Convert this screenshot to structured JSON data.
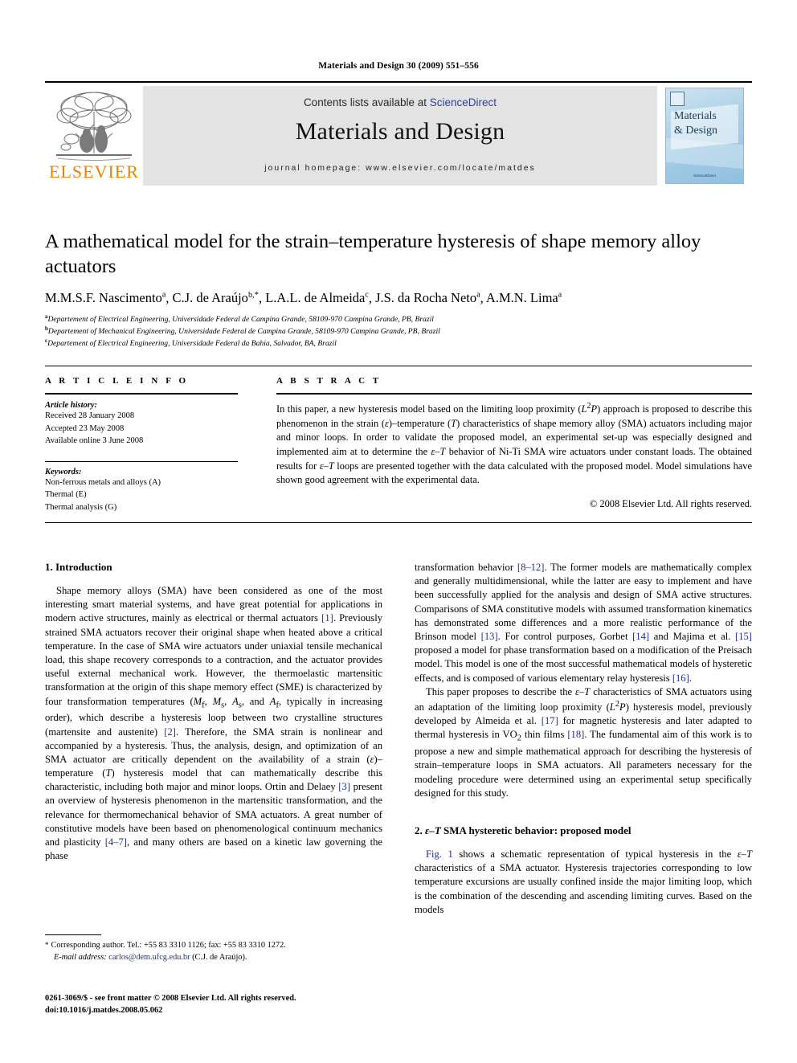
{
  "running_head": "Materials and Design 30 (2009) 551–556",
  "masthead": {
    "publisher_name": "ELSEVIER",
    "contents_prefix": "Contents lists available at ",
    "contents_link": "ScienceDirect",
    "journal_title": "Materials and Design",
    "homepage": "journal homepage: www.elsevier.com/locate/matdes",
    "cover_title_line1": "Materials",
    "cover_title_line2": "& Design",
    "cover_footer": "Available online at\nScienceDirect\nwww.sciencedirect.com"
  },
  "article": {
    "title": "A mathematical model for the strain–temperature hysteresis of shape memory alloy actuators",
    "authors": "M.M.S.F. Nascimento a, C.J. de Araújo b,*, L.A.L. de Almeida c, J.S. da Rocha Neto a, A.M.N. Lima a",
    "affiliations": [
      "Departement of Electrical Engineering, Universidade Federal de Campina Grande, 58109-970 Campina Grande, PB, Brazil",
      "Departement of Mechanical Engineering, Universidade Federal de Campina Grande, 58109-970 Campina Grande, PB, Brazil",
      "Departement of Electrical Engineering, Universidade Federal da Bahia, Salvador, BA, Brazil"
    ],
    "affiliation_marks": [
      "a",
      "b",
      "c"
    ]
  },
  "article_info": {
    "heading": "A R T I C L E   I N F O",
    "history_label": "Article history:",
    "history": [
      "Received 28 January 2008",
      "Accepted 23 May 2008",
      "Available online 3 June 2008"
    ],
    "keywords_label": "Keywords:",
    "keywords": [
      "Non-ferrous metals and alloys (A)",
      "Thermal (E)",
      "Thermal analysis (G)"
    ]
  },
  "abstract": {
    "heading": "A B S T R A C T",
    "text": "In this paper, a new hysteresis model based on the limiting loop proximity (L2P) approach is proposed to describe this phenomenon in the strain (ε)–temperature (T) characteristics of shape memory alloy (SMA) actuators including major and minor loops. In order to validate the proposed model, an experimental set-up was especially designed and implemented aim at to determine the ε–T behavior of Ni-Ti SMA wire actuators under constant loads. The obtained results for ε–T loops are presented together with the data calculated with the proposed model. Model simulations have shown good agreement with the experimental data.",
    "copyright": "© 2008 Elsevier Ltd. All rights reserved."
  },
  "sections": {
    "intro_heading": "1. Introduction",
    "model_heading": "2. ε–T SMA hysteretic behavior: proposed model",
    "intro_p1": "Shape memory alloys (SMA) have been considered as one of the most interesting smart material systems, and have great potential for applications in modern active structures, mainly as electrical or thermal actuators [1]. Previously strained SMA actuators recover their original shape when heated above a critical temperature. In the case of SMA wire actuators under uniaxial tensile mechanical load, this shape recovery corresponds to a contraction, and the actuator provides useful external mechanical work. However, the thermoelastic martensitic transformation at the origin of this shape memory effect (SME) is characterized by four transformation temperatures (Mf, Ms, As, and Af, typically in increasing order), which describe a hysteresis loop between two crystalline structures (martensite and austenite) [2]. Therefore, the SMA strain is nonlinear and accompanied by a hysteresis. Thus, the analysis, design, and optimization of an SMA actuator are critically dependent on the availability of a strain (ε)–temperature (T) hysteresis model that can mathematically describe this characteristic, including both major and minor loops. Ortin and Delaey [3] present an overview of hysteresis phenomenon in the martensitic transformation, and the relevance for thermomechanical behavior of SMA actuators. A great number of constitutive models have been based on phenomenological continuum mechanics and plasticity [4–7], and many others are based on a kinetic law governing the phase transformation behavior [8–12]. The former models are mathematically complex and generally multidimensional, while the latter are easy to implement and have been successfully applied for the analysis and design of SMA active structures. Comparisons of SMA constitutive models with assumed transformation kinematics has demonstrated some differences and a more realistic performance of the Brinson model [13]. For control purposes, Gorbet [14] and Majima et al. [15] proposed a model for phase transformation based on a modification of the Preisach model. This model is one of the most successful mathematical models of hysteretic effects, and is composed of various elementary relay hysteresis [16].",
    "intro_p2": "This paper proposes to describe the ε–T characteristics of SMA actuators using an adaptation of the limiting loop proximity (L2P) hysteresis model, previously developed by Almeida et al. [17] for magnetic hysteresis and later adapted to thermal hysteresis in VO2 thin films [18]. The fundamental aim of this work is to propose a new and simple mathematical approach for describing the hysteresis of strain–temperature loops in SMA actuators. All parameters necessary for the modeling procedure were determined using an experimental setup specifically designed for this study.",
    "model_p1": "Fig. 1 shows a schematic representation of typical hysteresis in the ε–T characteristics of a SMA actuator. Hysteresis trajectories corresponding to low temperature excursions are usually confined inside the major limiting loop, which is the combination of the descending and ascending limiting curves. Based on the models"
  },
  "footnote": {
    "marker": "*",
    "line1": "Corresponding author. Tel.: +55 83 3310 1126; fax: +55 83 3310 1272.",
    "email_label": "E-mail address:",
    "email": "carlos@dem.ufcg.edu.br",
    "email_suffix": "(C.J. de Araújo)."
  },
  "colophon": {
    "line1": "0261-3069/$ - see front matter © 2008 Elsevier Ltd. All rights reserved.",
    "line2": "doi:10.1016/j.matdes.2008.05.062"
  },
  "colors": {
    "link": "#1f2f8a",
    "sciencedirect": "#2b3fa0",
    "elsevier_orange": "#f08000",
    "band_gray": "#e3e3e3"
  }
}
